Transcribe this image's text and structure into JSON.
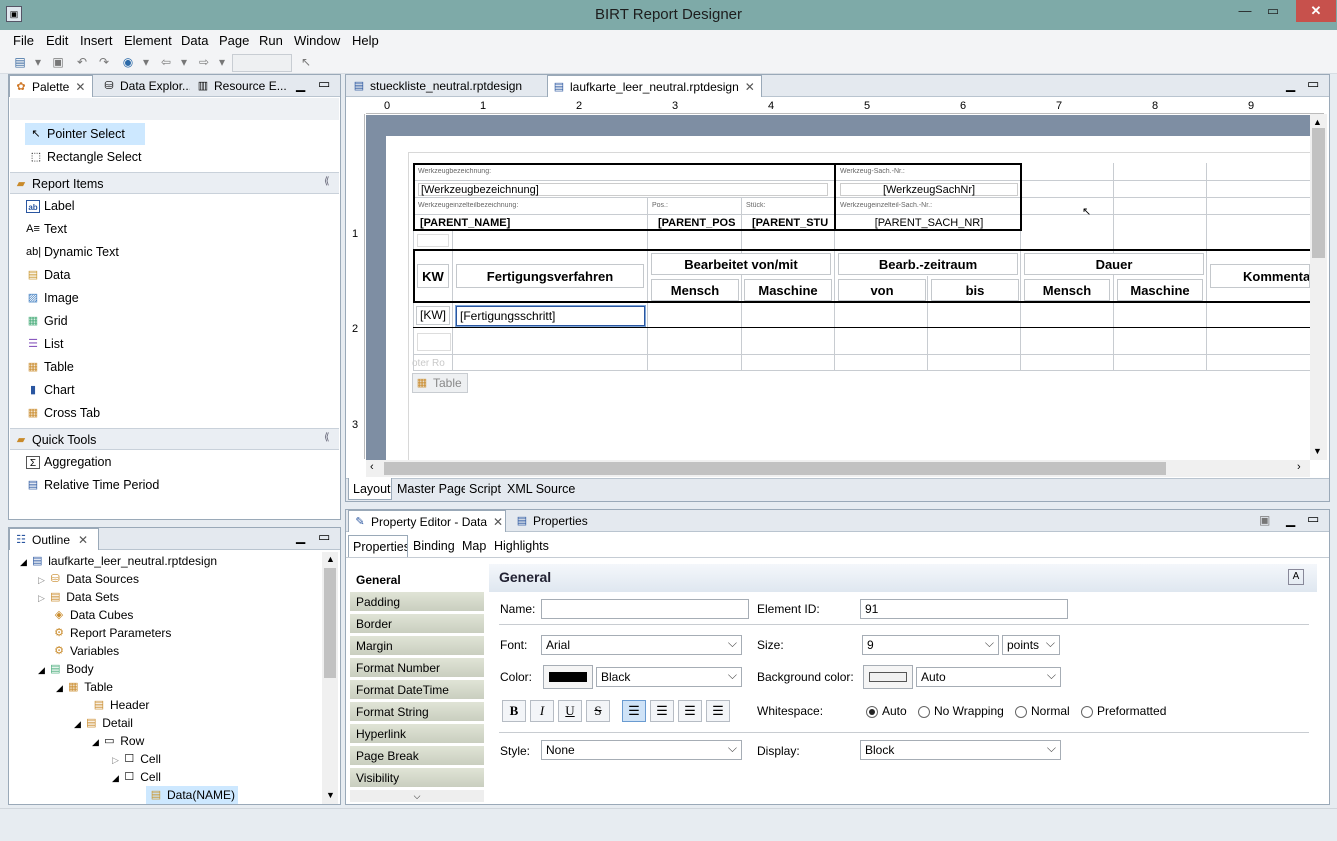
{
  "app": {
    "title": "BIRT Report Designer"
  },
  "menu": [
    "File",
    "Edit",
    "Insert",
    "Element",
    "Data",
    "Page",
    "Run",
    "Window",
    "Help"
  ],
  "palette": {
    "tabs": [
      "Palette",
      "Data Explor...",
      "Resource E..."
    ],
    "tools": [
      "Pointer Select",
      "Rectangle Select"
    ],
    "report_items_header": "Report Items",
    "report_items": [
      "Label",
      "Text",
      "Dynamic Text",
      "Data",
      "Image",
      "Grid",
      "List",
      "Table",
      "Chart",
      "Cross Tab"
    ],
    "quick_tools_header": "Quick Tools",
    "quick_tools": [
      "Aggregation",
      "Relative Time Period"
    ]
  },
  "outline": {
    "tab": "Outline",
    "items": [
      "laufkarte_leer_neutral.rptdesign",
      "Data Sources",
      "Data Sets",
      "Data Cubes",
      "Report Parameters",
      "Variables",
      "Body",
      "Table",
      "Header",
      "Detail",
      "Row",
      "Cell",
      "Cell",
      "Data(NAME)"
    ]
  },
  "editor": {
    "tabs": [
      "stueckliste_neutral.rptdesign",
      "laufkarte_leer_neutral.rptdesign"
    ],
    "ruler": [
      "0",
      "1",
      "2",
      "3",
      "4",
      "5",
      "6",
      "7",
      "8",
      "9"
    ],
    "vruler": [
      "1",
      "2",
      "3"
    ],
    "bottom_tabs": [
      "Layout",
      "Master Page",
      "Script",
      "XML Source"
    ],
    "header_labels": {
      "wz_bez": "Werkzeugbezeichnung:",
      "wz_sach": "Werkzeug-Sach.-Nr.:",
      "wz_teil": "Werkzeugeinzelteilbezeichnung:",
      "pos": "Pos.:",
      "stueck": "Stück:",
      "teil_sach": "Werkzeugeinzelteil-Sach.-Nr.:"
    },
    "header_values": {
      "wz_bez": "[Werkzeugbezeichnung]",
      "wz_sach": "[WerkzeugSachNr]",
      "name": "[PARENT_NAME]",
      "pos": "[PARENT_POS",
      "stu": "[PARENT_STU",
      "sachnr": "[PARENT_SACH_NR]"
    },
    "table_headers": {
      "kw": "KW",
      "fv": "Fertigungsverfahren",
      "bearbeitet": "Bearbeitet von/mit",
      "zeitraum": "Bearb.-zeitraum",
      "dauer": "Dauer",
      "mensch": "Mensch",
      "maschine": "Maschine",
      "von": "von",
      "bis": "bis",
      "mensch2": "Mensch",
      "maschine2": "Maschine",
      "kommentar": "Kommenta"
    },
    "detail": {
      "kw": "[KW]",
      "fs": "[Fertigungsschritt]"
    },
    "footer_label": "oter Ro",
    "table_badge": "Table"
  },
  "props": {
    "tabs": [
      "Property Editor - Data",
      "Properties"
    ],
    "subtabs": [
      "Properties",
      "Binding",
      "Map",
      "Highlights"
    ],
    "categories": [
      "General",
      "Padding",
      "Border",
      "Margin",
      "Format Number",
      "Format DateTime",
      "Format String",
      "Hyperlink",
      "Page Break",
      "Visibility"
    ],
    "section_title": "General",
    "name_label": "Name:",
    "name_value": "",
    "id_label": "Element ID:",
    "id_value": "91",
    "font_label": "Font:",
    "font_value": "Arial",
    "size_label": "Size:",
    "size_value": "9",
    "size_unit": "points",
    "color_label": "Color:",
    "color_value": "Black",
    "color_swatch": "#000000",
    "bg_label": "Background color:",
    "bg_value": "Auto",
    "ws_label": "Whitespace:",
    "ws_options": [
      "Auto",
      "No Wrapping",
      "Normal",
      "Preformatted"
    ],
    "style_label": "Style:",
    "style_value": "None",
    "display_label": "Display:",
    "display_value": "Block"
  },
  "colors": {
    "titlebar": "#7eaaa8",
    "close": "#c7514c",
    "selection": "#cde8ff"
  }
}
